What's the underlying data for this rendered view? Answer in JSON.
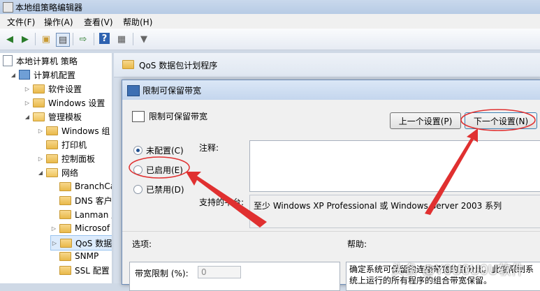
{
  "window": {
    "title": "本地组策略编辑器"
  },
  "menu": [
    "文件(F)",
    "操作(A)",
    "查看(V)",
    "帮助(H)"
  ],
  "toolbar_icons": [
    "back-icon",
    "forward-icon",
    "up-folder-icon",
    "show-hide-tree-icon",
    "export-icon",
    "help-icon",
    "properties-icon",
    "filter-icon"
  ],
  "tree": {
    "items": [
      {
        "label": "本地计算机 策略"
      },
      {
        "label": "计算机配置"
      },
      {
        "label": "软件设置"
      },
      {
        "label": "Windows 设置"
      },
      {
        "label": "管理模板"
      },
      {
        "label": "Windows 组"
      },
      {
        "label": "打印机"
      },
      {
        "label": "控制面板"
      },
      {
        "label": "网络"
      },
      {
        "label": "BranchCa"
      },
      {
        "label": "DNS 客户"
      },
      {
        "label": "Lanman 服"
      },
      {
        "label": "Microsof"
      },
      {
        "label": "QoS 数据"
      },
      {
        "label": "SNMP"
      },
      {
        "label": "SSL 配置"
      }
    ]
  },
  "right_pane": {
    "header": "QoS 数据包计划程序"
  },
  "dialog": {
    "title": "限制可保留带宽",
    "policy_name": "限制可保留带宽",
    "prev_button": "上一个设置(P)",
    "next_button": "下一个设置(N)",
    "radio_not_configured": "未配置(C)",
    "radio_enabled": "已启用(E)",
    "radio_disabled": "已禁用(D)",
    "comment_label": "注释:",
    "platform_label": "支持的平台:",
    "platform_value": "至少 Windows XP Professional 或 Windows Server 2003 系列",
    "options_label": "选项:",
    "help_label": "帮助:",
    "bandwidth_label": "带宽限制 (%):",
    "bandwidth_value": "0",
    "help_text": "确定系统可保留的连接带宽的百分比。此值限制系统上运行的所有程序的组合带宽保留。"
  },
  "watermark": "头条 @Y0U0U0U软件",
  "colors": {
    "annotation": "#e03030"
  }
}
